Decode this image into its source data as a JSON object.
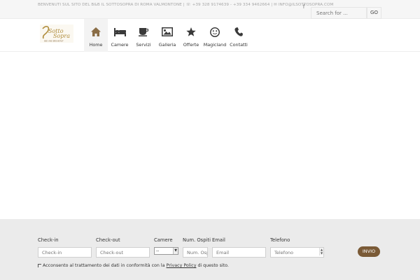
{
  "topbar": {
    "info_text": "BENVENUTI SUL SITO DEL B&B IL SOTTOSOPRA DI ROMA VALMONTONE  |  ☏ +39 328 9174639 - +39 334 9462664  |  ✉ INFO@ILSOTTOSOPRA.COM",
    "search_placeholder": "Search for ...",
    "go_label": "GO",
    "facebook_icon": "facebook-icon"
  },
  "logo": {
    "line1": "Sotto",
    "line2": "Sopra",
    "tagline": "BED AND BREAKFAST"
  },
  "nav": [
    {
      "label": "Home",
      "icon": "home-icon",
      "active": true
    },
    {
      "label": "Camere",
      "icon": "bed-icon",
      "active": false
    },
    {
      "label": "Servizi",
      "icon": "coffee-icon",
      "active": false
    },
    {
      "label": "Galleria",
      "icon": "image-icon",
      "active": false
    },
    {
      "label": "Offerte",
      "icon": "star-icon",
      "active": false
    },
    {
      "label": "Magicland",
      "icon": "smile-icon",
      "active": false
    },
    {
      "label": "Contatti",
      "icon": "phone-icon",
      "active": false
    }
  ],
  "booking": {
    "checkin_label": "Check-in",
    "checkin_placeholder": "Check-in",
    "checkout_label": "Check-out",
    "checkout_placeholder": "Check-out",
    "rooms_label": "Camere",
    "rooms_value": "--",
    "guests_label": "Num. Ospiti",
    "guests_placeholder": "Num. Ospiti",
    "email_label": "Email",
    "email_placeholder": "Email",
    "phone_label": "Telefono",
    "phone_placeholder": "Telefono",
    "submit_label": "INVIO",
    "privacy_prefix": "Acconsento al trattamento dei dati in conformità con la ",
    "privacy_link": "Privacy Policy",
    "privacy_suffix": " di questo sito."
  },
  "colors": {
    "accent": "#8a6d46",
    "button": "#7a5a36",
    "footer_bg": "#ebebeb"
  }
}
